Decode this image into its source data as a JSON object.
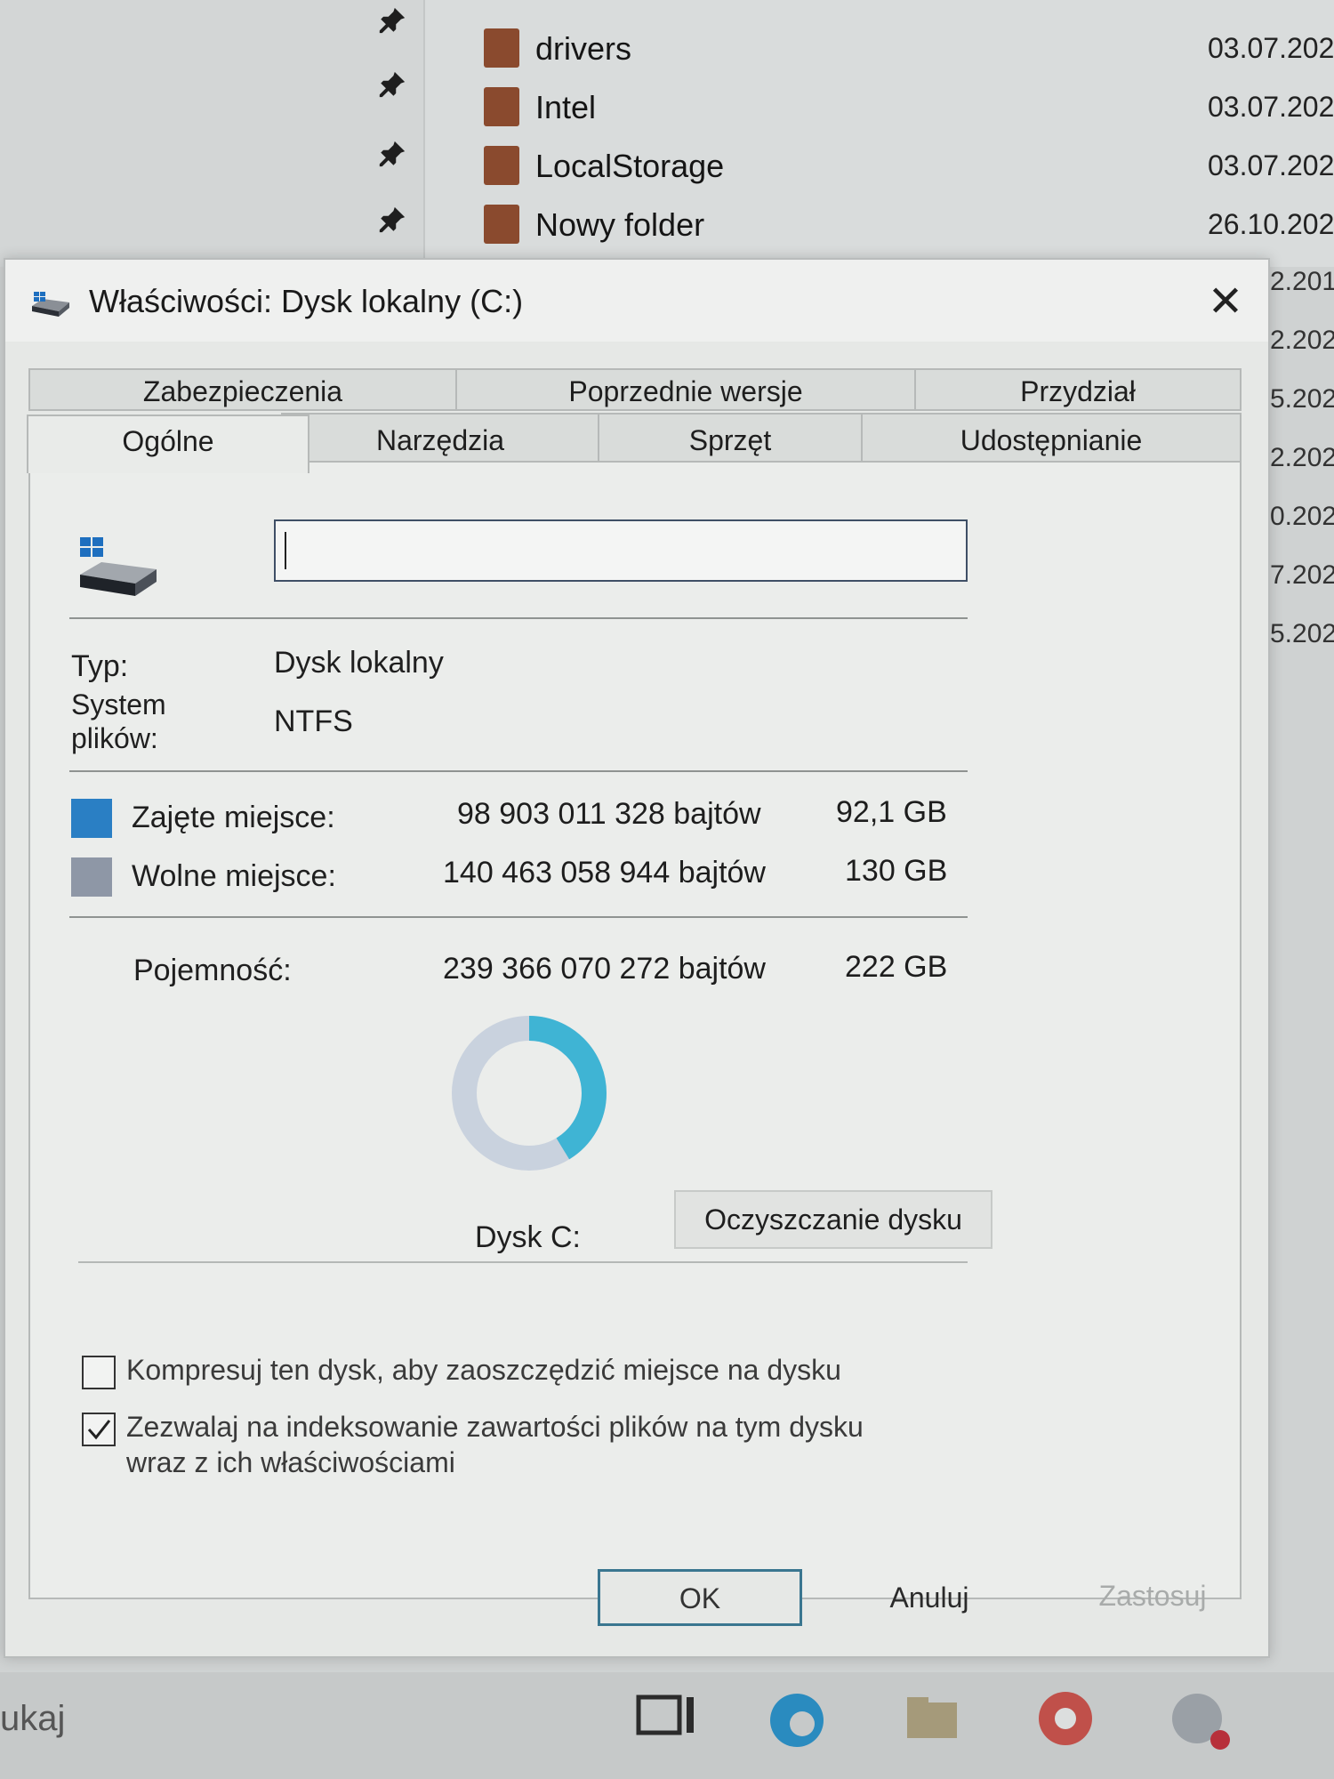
{
  "explorer": {
    "files": [
      {
        "name": "drivers",
        "date": "03.07.202"
      },
      {
        "name": "Intel",
        "date": "03.07.202"
      },
      {
        "name": "LocalStorage",
        "date": "03.07.202"
      },
      {
        "name": "Nowy folder",
        "date": "26.10.202"
      }
    ],
    "right_dates": [
      "2.201",
      "2.202",
      "5.202",
      "2.202",
      "0.202",
      "7.202",
      "5.202"
    ]
  },
  "dialog": {
    "title": "Właściwości: Dysk lokalny (C:)",
    "close": "✕",
    "tabs_row1": [
      "Zabezpieczenia",
      "Poprzednie wersje",
      "Przydział"
    ],
    "tabs_row2": [
      "Ogólne",
      "Narzędzia",
      "Sprzęt",
      "Udostępnianie"
    ],
    "active_tab": "Ogólne",
    "name_value": "",
    "type_label": "Typ:",
    "type_value": "Dysk lokalny",
    "fs_label_line1": "System",
    "fs_label_line2": "plików:",
    "fs_value": "NTFS",
    "used_label": "Zajęte miejsce:",
    "used_bytes": "98 903 011 328 bajtów",
    "used_gb": "92,1 GB",
    "free_label": "Wolne miejsce:",
    "free_bytes": "140 463 058 944 bajtów",
    "free_gb": "130 GB",
    "capacity_label": "Pojemność:",
    "capacity_bytes": "239 366 070 272 bajtów",
    "capacity_gb": "222 GB",
    "used_fraction": 0.413,
    "drive_label": "Dysk C:",
    "cleanup_button": "Oczyszczanie dysku",
    "compress_label": "Kompresuj ten dysk, aby zaoszczędzić miejsce na dysku",
    "compress_checked": false,
    "index_label_line1": "Zezwalaj na indeksowanie zawartości plików na tym dysku",
    "index_label_line2": "wraz z ich właściwościami",
    "index_checked": true,
    "ok": "OK",
    "cancel": "Anuluj",
    "apply": "Zastosuj",
    "colors": {
      "used": "#2a7fc4",
      "free": "#8e97a6",
      "donut_used": "#3fb4d4",
      "donut_free": "#c9d2de"
    }
  },
  "taskbar": {
    "search_text": "ukaj"
  }
}
